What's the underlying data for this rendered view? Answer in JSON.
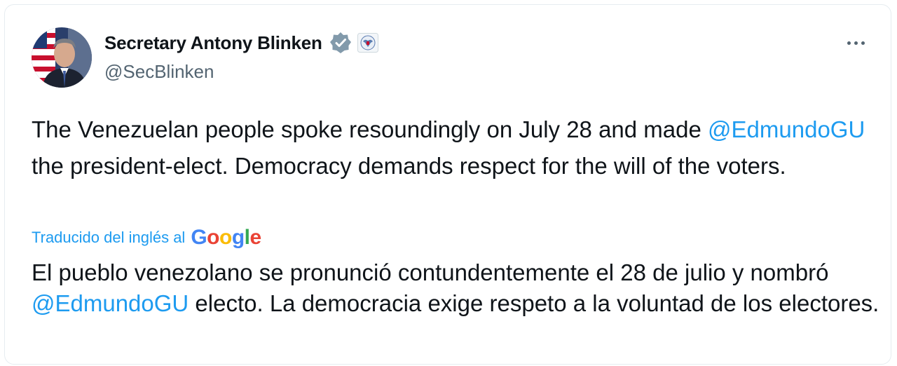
{
  "author": {
    "display_name": "Secretary Antony Blinken",
    "handle": "@SecBlinken",
    "verified_badge_color": "#829aab"
  },
  "tweet": {
    "original": {
      "part1": "The Venezuelan people spoke resoundingly on July 28 and made ",
      "mention": "@EdmundoGU",
      "part2": " the president-elect. Democracy demands respect for the will of the voters."
    },
    "translation_label": "Traducido del inglés al",
    "translation_provider": {
      "letters": [
        "G",
        "o",
        "o",
        "g",
        "l",
        "e"
      ]
    },
    "translated": {
      "part1": "El pueblo venezolano se pronunció contundentemente el 28 de julio y nombró ",
      "mention": "@EdmundoGU",
      "part2": " electo. La democracia exige respeto a la voluntad de los electores."
    }
  },
  "icons": {
    "more": "more-icon",
    "verified": "verified-badge-icon",
    "affiliation": "state-department-seal-icon"
  },
  "colors": {
    "link": "#1d9bf0",
    "secondary_text": "#536471",
    "primary_text": "#0f1419"
  }
}
